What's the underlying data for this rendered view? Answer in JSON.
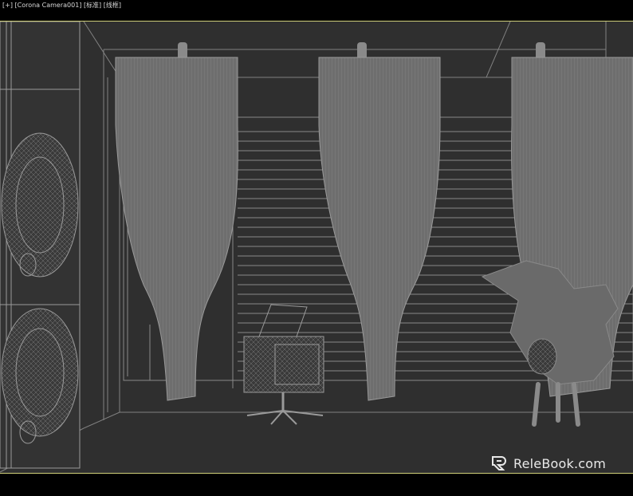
{
  "viewport": {
    "label": "[+] [Corona Camera001] [标准] [线框]",
    "name": "Corona Camera001",
    "shading_mode": "wireframe"
  },
  "watermark": {
    "text": "ReleBook.com",
    "icon": "relebook-logo-icon"
  },
  "colors": {
    "viewport_bg": "#2f2f2f",
    "wire": "#8a8a8a",
    "mesh_fill": "#7a7a7a",
    "viewport_border": "#cfcf7a",
    "window_bg": "#000000"
  },
  "scene_objects": [
    "wall-shelf",
    "curtain-left",
    "curtain-middle",
    "curtain-right",
    "window-blinds",
    "cage-cabinet-with-swivel-base",
    "plant-stool"
  ]
}
